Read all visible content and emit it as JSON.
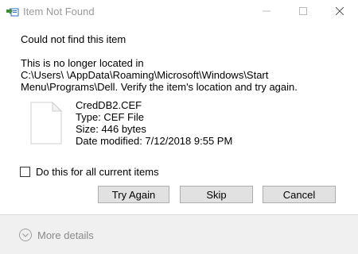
{
  "window": {
    "title": "Item Not Found",
    "minimize_icon": "minimize-icon",
    "maximize_icon": "maximize-icon",
    "close_icon": "close-icon",
    "app_icon": "file-move-icon"
  },
  "content": {
    "heading": "Could not find this item",
    "message_lines": [
      "This is no longer located in",
      "C:\\Users\\          \\AppData\\Roaming\\Microsoft\\Windows\\Start",
      "Menu\\Programs\\Dell. Verify the item's location and try again."
    ],
    "file": {
      "icon": "blank-file-icon",
      "name": "CredDB2.CEF",
      "type": "Type: CEF File",
      "size": "Size: 446 bytes",
      "modified": "Date modified: 7/12/2018 9:55 PM"
    },
    "checkbox": {
      "label": "Do this for all current items",
      "checked": false
    }
  },
  "buttons": {
    "try_again": "Try Again",
    "skip": "Skip",
    "cancel": "Cancel"
  },
  "footer": {
    "more_details": "More details",
    "icon": "chevron-down-circle-icon"
  },
  "colors": {
    "title_text": "#999999",
    "button_bg": "#e1e1e1",
    "button_border": "#adadad",
    "footer_bg": "#f0f0f0",
    "footer_text": "#8a8a8a",
    "icon_green": "#3c8c3c",
    "icon_blue": "#2a6fc4"
  }
}
